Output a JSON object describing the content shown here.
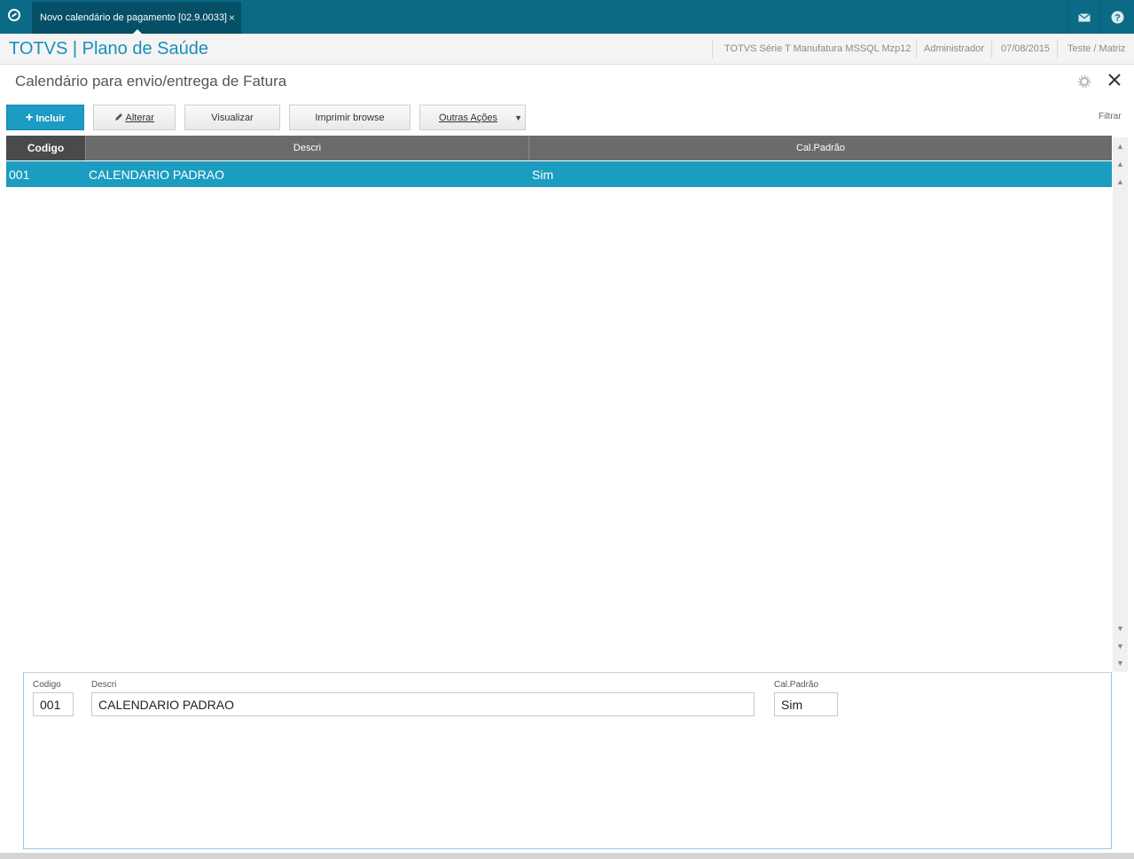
{
  "tab": {
    "label": "Novo calendário de pagamento [02.9.0033]",
    "close": "×"
  },
  "icons": {
    "logo": "totvs-logo-icon",
    "mail": "mail-icon",
    "help": "help-icon",
    "gear": "gear-icon",
    "close": "close-icon",
    "plus": "plus-icon",
    "pencil": "pencil-icon",
    "dropdown": "chevron-down-icon"
  },
  "header": {
    "app_title": "TOTVS | Plano de Saúde",
    "environment": "TOTVS Série T Manufatura MSSQL Mzp12",
    "user": "Administrador",
    "date": "07/08/2015",
    "company": "Teste / Matriz"
  },
  "page": {
    "title": "Calendário para envio/entrega de Fatura"
  },
  "toolbar": {
    "incluir": "Incluir",
    "alterar": "Alterar",
    "visualizar": "Visualizar",
    "imprimir": "Imprimir browse",
    "outras": "Outras Ações",
    "filtrar": "Filtrar"
  },
  "grid": {
    "columns": [
      "Codigo",
      "Descri",
      "Cal.Padrão"
    ],
    "rows": [
      {
        "codigo": "001",
        "descri": "CALENDARIO PADRAO",
        "cal_padrao": "Sim"
      }
    ]
  },
  "detail": {
    "codigo_label": "Codigo",
    "codigo_value": "001",
    "descri_label": "Descri",
    "descri_value": "CALENDARIO PADRAO",
    "cal_label": "Cal.Padrão",
    "cal_value": "Sim"
  },
  "colors": {
    "topbar": "#0b6a85",
    "accent": "#1b9dc1",
    "title": "#1a8fb8"
  }
}
